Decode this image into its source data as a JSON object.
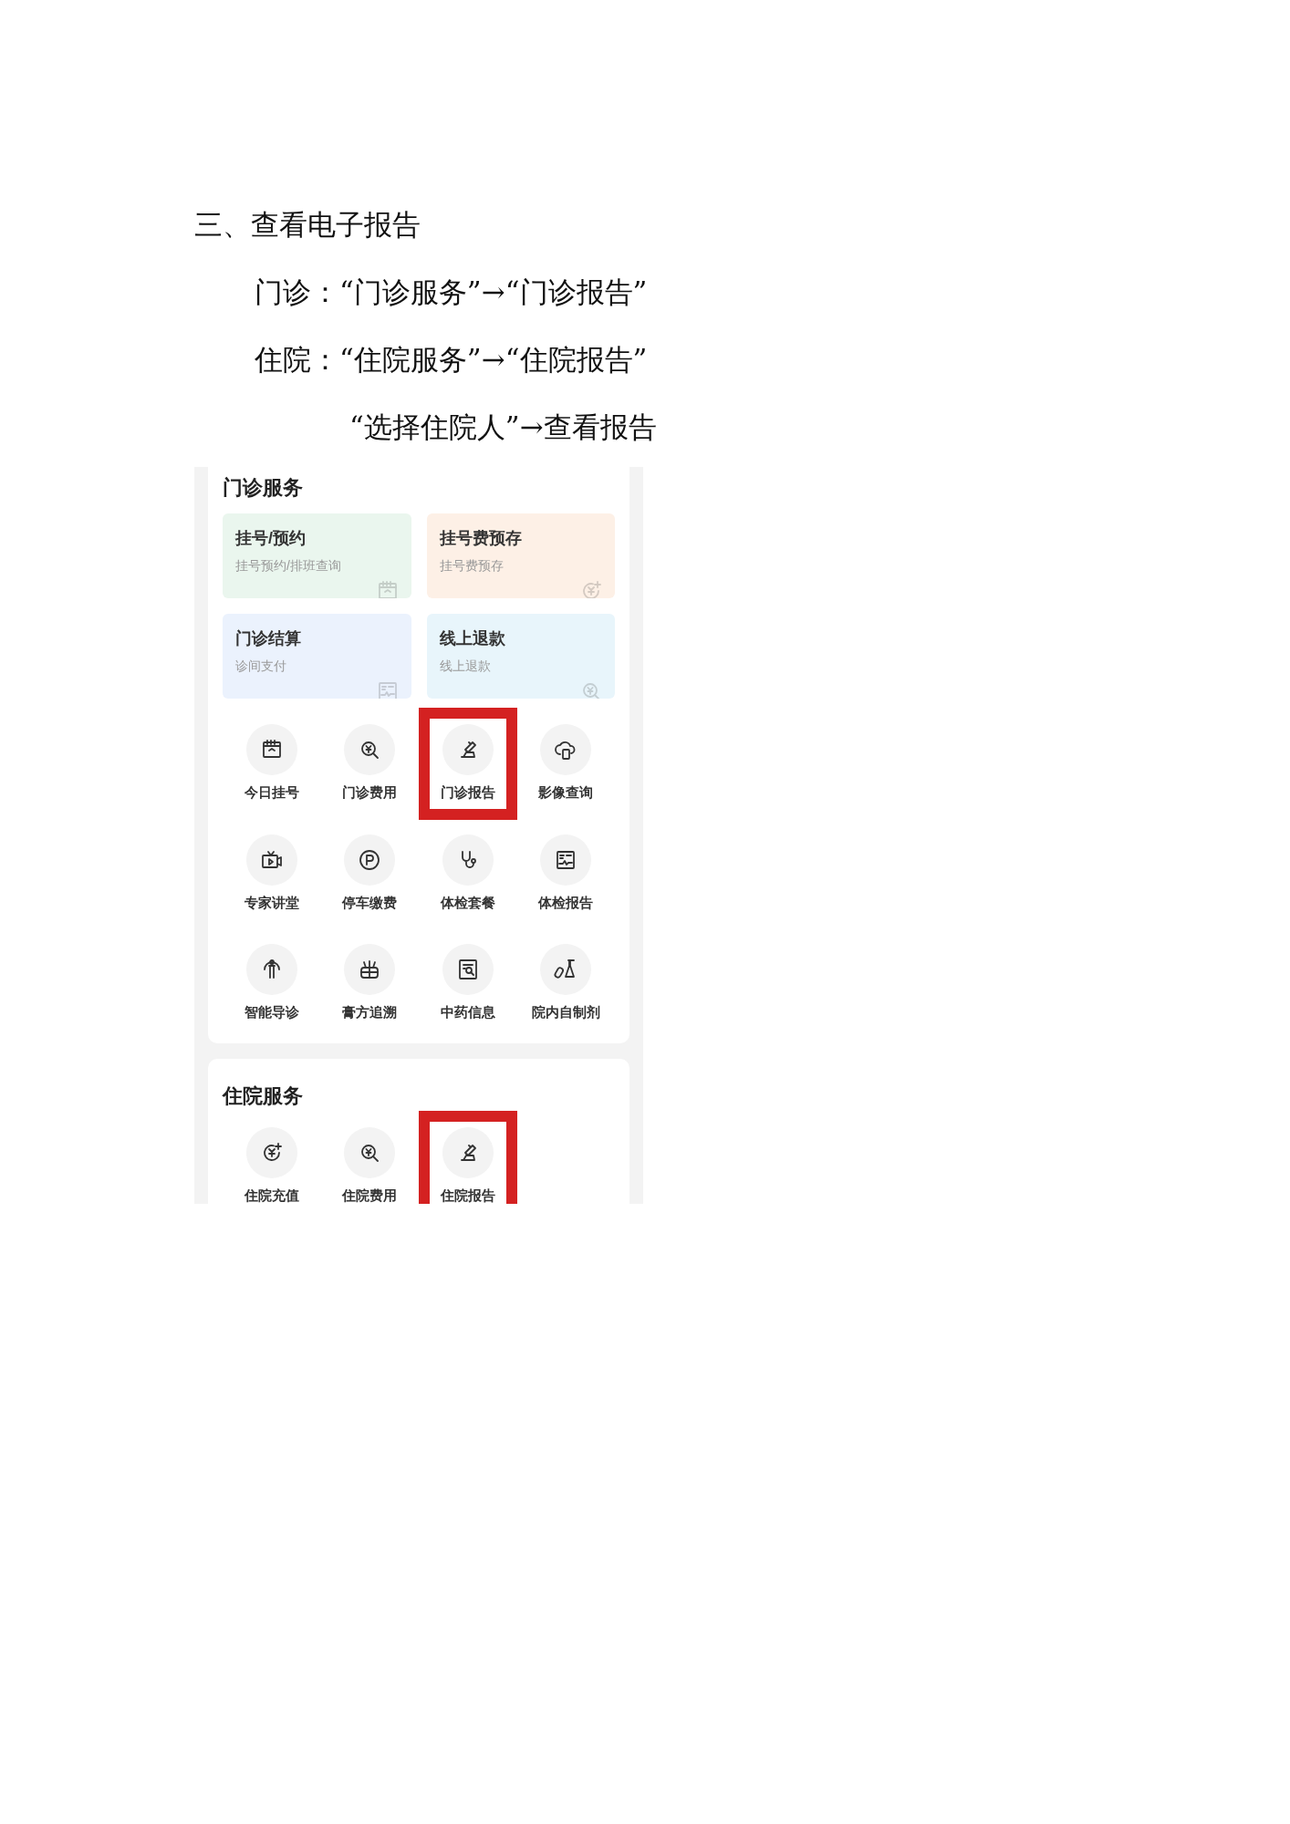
{
  "document": {
    "heading": "三、查看电子报告",
    "steps": [
      "门诊：“门诊服务”→“门诊报告”",
      "住院：“住院服务”→“住院报告”",
      "“选择住院人”→查看报告"
    ]
  },
  "screenshot": {
    "sections": [
      {
        "title": "门诊服务",
        "tiles": [
          {
            "title": "挂号/预约",
            "subtitle": "挂号预约/排班查询",
            "color": "#eaf6ee"
          },
          {
            "title": "挂号费预存",
            "subtitle": "挂号费预存",
            "color": "#fdf0e6"
          },
          {
            "title": "门诊结算",
            "subtitle": "诊间支付",
            "color": "#ebf2fd"
          },
          {
            "title": "线上退款",
            "subtitle": "线上退款",
            "color": "#e8f5fb"
          }
        ],
        "items": [
          {
            "label": "今日挂号",
            "highlighted": false
          },
          {
            "label": "门诊费用",
            "highlighted": false
          },
          {
            "label": "门诊报告",
            "highlighted": true
          },
          {
            "label": "影像查询",
            "highlighted": false
          },
          {
            "label": "专家讲堂",
            "highlighted": false
          },
          {
            "label": "停车缴费",
            "highlighted": false
          },
          {
            "label": "体检套餐",
            "highlighted": false
          },
          {
            "label": "体检报告",
            "highlighted": false
          },
          {
            "label": "智能导诊",
            "highlighted": false
          },
          {
            "label": "膏方追溯",
            "highlighted": false
          },
          {
            "label": "中药信息",
            "highlighted": false
          },
          {
            "label": "院内自制剂",
            "highlighted": false
          }
        ]
      },
      {
        "title": "住院服务",
        "items": [
          {
            "label": "住院充值",
            "highlighted": false
          },
          {
            "label": "住院费用",
            "highlighted": false
          },
          {
            "label": "住院报告",
            "highlighted": true
          }
        ]
      }
    ]
  }
}
